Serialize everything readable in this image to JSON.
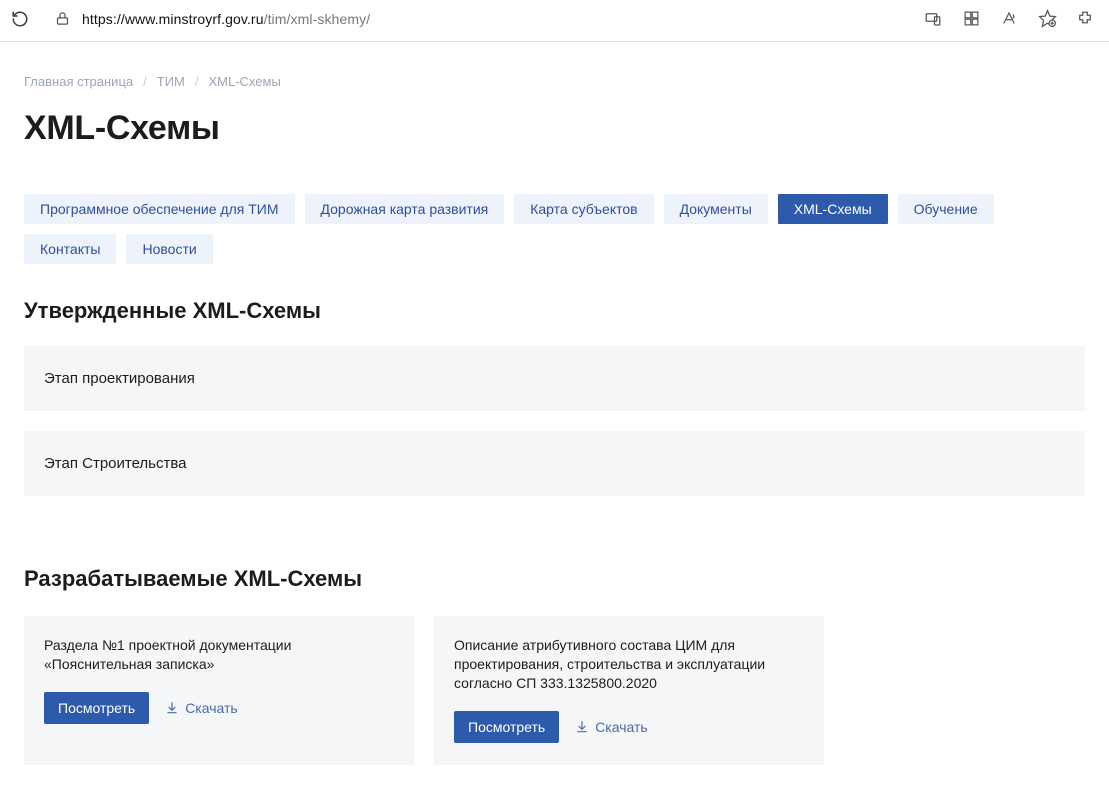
{
  "browser": {
    "url_host": "https://www.minstroyrf.gov.ru",
    "url_path": "/tim/xml-skhemy/"
  },
  "breadcrumb": {
    "items": [
      {
        "label": "Главная страница"
      },
      {
        "label": "ТИМ"
      }
    ],
    "current": "XML-Схемы",
    "sep": "/"
  },
  "page_title": "XML-Схемы",
  "tabs": [
    {
      "label": "Программное обеспечение для ТИМ",
      "active": false
    },
    {
      "label": "Дорожная карта развития",
      "active": false
    },
    {
      "label": "Карта субъектов",
      "active": false
    },
    {
      "label": "Документы",
      "active": false
    },
    {
      "label": "XML-Схемы",
      "active": true
    },
    {
      "label": "Обучение",
      "active": false
    },
    {
      "label": "Контакты",
      "active": false
    },
    {
      "label": "Новости",
      "active": false
    }
  ],
  "sections": {
    "approved": {
      "heading": "Утвержденные XML-Схемы",
      "items": [
        {
          "label": "Этап проектирования"
        },
        {
          "label": "Этап Строительства"
        }
      ]
    },
    "developing": {
      "heading": "Разрабатываемые XML-Схемы",
      "cards": [
        {
          "text": "Раздела №1 проектной документации «Пояснительная записка»",
          "view_label": "Посмотреть",
          "download_label": "Скачать"
        },
        {
          "text": "Описание атрибутивного состава ЦИМ для проектирования, строительства и эксплуатации согласно СП 333.1325800.2020",
          "view_label": "Посмотреть",
          "download_label": "Скачать"
        }
      ]
    }
  }
}
